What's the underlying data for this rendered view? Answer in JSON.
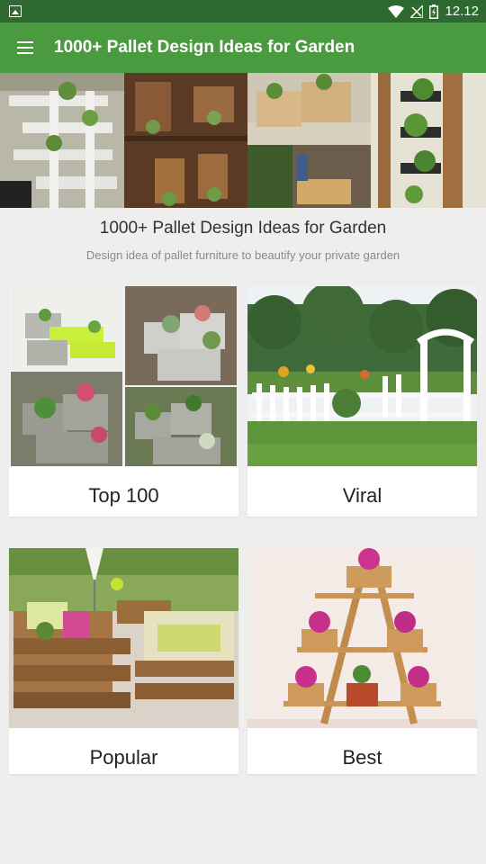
{
  "status_bar": {
    "time": "12.12"
  },
  "app_bar": {
    "title": "1000+ Pallet Design Ideas for Garden"
  },
  "header": {
    "title": "1000+ Pallet Design Ideas for Garden",
    "subtitle": "Design idea of pallet furniture to beautify your private garden"
  },
  "categories": [
    {
      "label": "Top 100"
    },
    {
      "label": "Viral"
    },
    {
      "label": "Popular"
    },
    {
      "label": "Best"
    }
  ],
  "colors": {
    "status_bar": "#2e6a2f",
    "app_bar": "#4a9a3f",
    "background": "#eeeeee"
  }
}
